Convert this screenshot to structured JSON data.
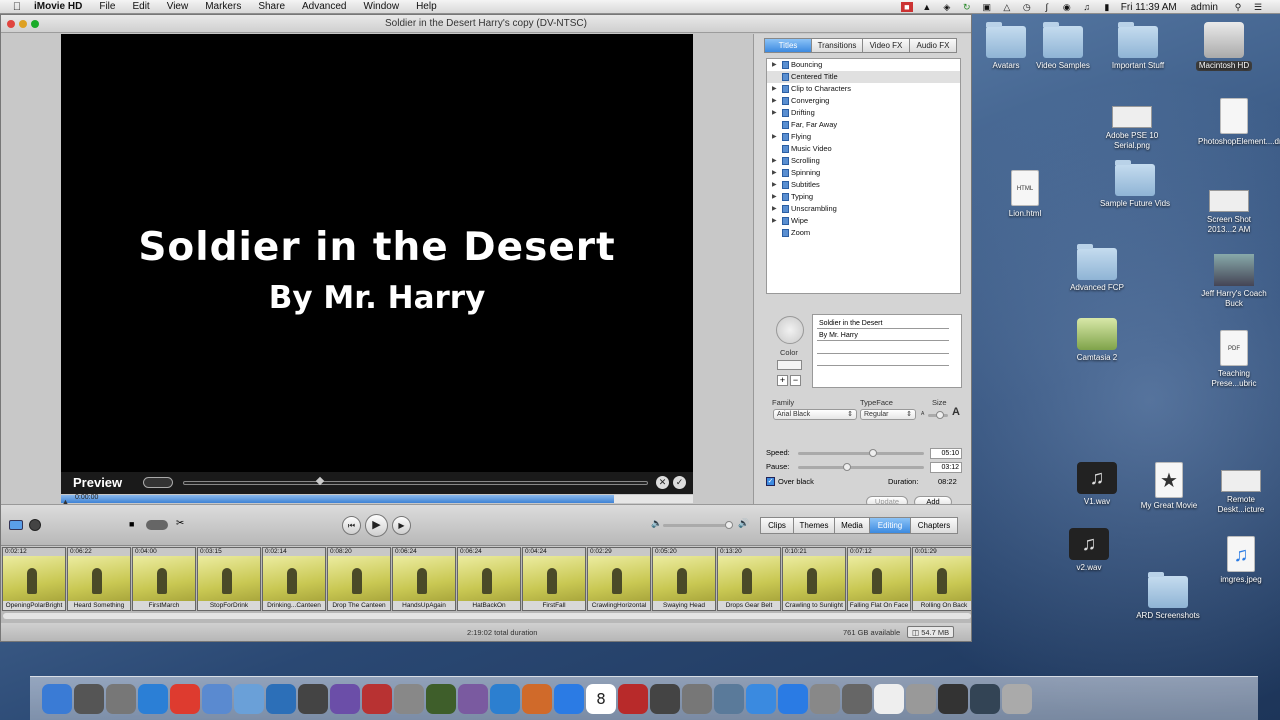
{
  "menubar": {
    "app": "iMovie HD",
    "items": [
      "File",
      "Edit",
      "View",
      "Markers",
      "Share",
      "Advanced",
      "Window",
      "Help"
    ],
    "clock": "Fri 11:39 AM",
    "user": "admin"
  },
  "window": {
    "title": "Soldier in the Desert Harry's copy (DV-NTSC)"
  },
  "preview": {
    "title_text": "Soldier in the Desert",
    "subtitle_text": "By Mr. Harry",
    "label": "Preview",
    "timecode": "0:00:00"
  },
  "panel": {
    "tabs": [
      "Titles",
      "Transitions",
      "Video FX",
      "Audio FX"
    ],
    "active_tab": "Titles",
    "titles": [
      {
        "name": "Bouncing",
        "expand": true
      },
      {
        "name": "Centered Title",
        "expand": false,
        "selected": true
      },
      {
        "name": "Clip to Characters",
        "expand": true
      },
      {
        "name": "Converging",
        "expand": true
      },
      {
        "name": "Drifting",
        "expand": true
      },
      {
        "name": "Far, Far Away",
        "expand": false
      },
      {
        "name": "Flying",
        "expand": true
      },
      {
        "name": "Music Video",
        "expand": false
      },
      {
        "name": "Scrolling",
        "expand": true
      },
      {
        "name": "Spinning",
        "expand": true
      },
      {
        "name": "Subtitles",
        "expand": true
      },
      {
        "name": "Typing",
        "expand": true
      },
      {
        "name": "Unscrambling",
        "expand": true
      },
      {
        "name": "Wipe",
        "expand": true
      },
      {
        "name": "Zoom",
        "expand": false
      }
    ],
    "color_label": "Color",
    "text_lines": [
      "Soldier in the Desert",
      "By Mr. Harry"
    ],
    "family_label": "Family",
    "family_value": "Arial Black",
    "typeface_label": "TypeFace",
    "typeface_value": "Regular",
    "size_label": "Size",
    "size_small": "A",
    "size_big": "A",
    "speed_label": "Speed:",
    "speed_value": "05:10",
    "speed_level": 0.6,
    "pause_label": "Pause:",
    "pause_value": "03:12",
    "pause_level": 0.38,
    "over_black_label": "Over black",
    "duration_label": "Duration:",
    "duration_value": "08:22",
    "update_label": "Update",
    "add_label": "Add"
  },
  "toolbar": {
    "tabs": [
      "Clips",
      "Themes",
      "Media",
      "Editing",
      "Chapters"
    ],
    "active_tab": "Editing"
  },
  "clips": [
    {
      "dur": "0:02:12",
      "name": "OpeningPolarBright"
    },
    {
      "dur": "0:06:22",
      "name": "Heard Something"
    },
    {
      "dur": "0:04:00",
      "name": "FirstMarch"
    },
    {
      "dur": "0:03:15",
      "name": "StopForDrink"
    },
    {
      "dur": "0:02:14",
      "name": "Drinking...Canteen"
    },
    {
      "dur": "0:08:20",
      "name": "Drop The Canteen"
    },
    {
      "dur": "0:06:24",
      "name": "HandsUpAgain"
    },
    {
      "dur": "0:06:24",
      "name": "HatBackOn"
    },
    {
      "dur": "0:04:24",
      "name": "FirstFall"
    },
    {
      "dur": "0:02:29",
      "name": "CrawlingHorizontal"
    },
    {
      "dur": "0:05:20",
      "name": "Swaying Head"
    },
    {
      "dur": "0:13:20",
      "name": "Drops Gear Belt"
    },
    {
      "dur": "0:10:21",
      "name": "Crawling to Sunlight"
    },
    {
      "dur": "0:07:12",
      "name": "Falling Flat On Face"
    },
    {
      "dur": "0:01:29",
      "name": "Rolling On Back"
    }
  ],
  "status": {
    "total": "2:19:02 total duration",
    "available": "761 GB available",
    "size": "54.7 MB"
  },
  "desktop": {
    "icons": [
      {
        "label": "Avatars",
        "kind": "folder"
      },
      {
        "label": "Video Samples",
        "kind": "folder"
      },
      {
        "label": "Important Stuff",
        "kind": "folder"
      },
      {
        "label": "Macintosh HD",
        "kind": "drive"
      },
      {
        "label": "Adobe PSE 10 Serial.png",
        "kind": "shot"
      },
      {
        "label": "PhotoshopElement....dmg",
        "kind": "doc"
      },
      {
        "label": "Lion.html",
        "kind": "html"
      },
      {
        "label": "Sample Future Vids",
        "kind": "folder"
      },
      {
        "label": "Screen Shot 2013...2 AM",
        "kind": "shot"
      },
      {
        "label": "Advanced FCP",
        "kind": "folder"
      },
      {
        "label": "Jeff Harry's Coach Buck",
        "kind": "photo"
      },
      {
        "label": "Camtasia 2",
        "kind": "app"
      },
      {
        "label": "Teaching Prese...ubric",
        "kind": "pdf"
      },
      {
        "label": "V1.wav",
        "kind": "audio"
      },
      {
        "label": "My Great Movie",
        "kind": "movie"
      },
      {
        "label": "Remote Deskt...icture",
        "kind": "shot"
      },
      {
        "label": "v2.wav",
        "kind": "audio"
      },
      {
        "label": "imgres.jpeg",
        "kind": "music"
      },
      {
        "label": "ARD Screenshots",
        "kind": "folder"
      }
    ],
    "html_badge": "HTML",
    "pdf_badge": "PDF"
  },
  "dock": {
    "items": [
      "finder-icon",
      "launchpad-icon",
      "app-store-icon",
      "safari-icon",
      "chrome-icon",
      "preview-icon",
      "mail-icon",
      "iphoto-icon",
      "aperture-icon",
      "imovie-icon",
      "dictionary-icon",
      "calculator-icon",
      "motion-icon",
      "filemerge-icon",
      "iphone-icon",
      "keynote-icon",
      "word-icon",
      "calendar-icon",
      "photo-booth-icon",
      "facetime-icon",
      "photos-icon",
      "image-capture-icon",
      "itunes-icon",
      "software-update-icon",
      "system-prefs-icon",
      "network-icon",
      "document-icon",
      "stack-icon",
      "monitor-icon",
      "screens-icon",
      "trash-icon"
    ],
    "calendar_day": "8"
  }
}
